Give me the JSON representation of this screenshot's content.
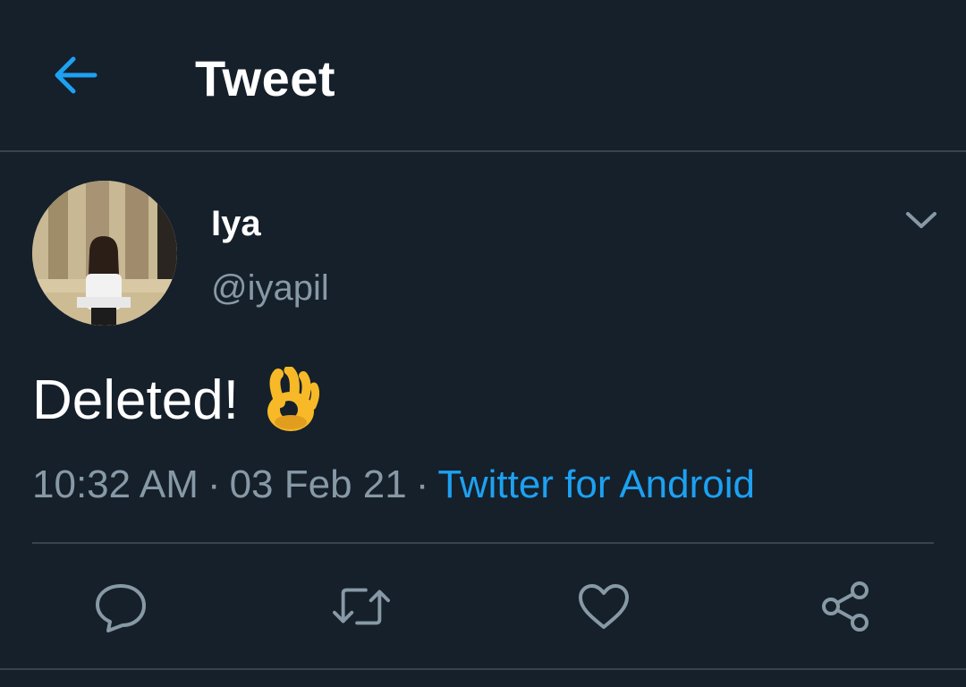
{
  "header": {
    "title": "Tweet",
    "back_icon": "arrow-left-icon"
  },
  "tweet": {
    "author_name": "Iya",
    "author_handle": "@iyapil",
    "text": "Deleted!",
    "emoji": "ok-hand-emoji",
    "time": "10:32 AM",
    "date": "03 Feb 21",
    "source": "Twitter for Android",
    "separator": "·"
  },
  "actions": [
    {
      "name": "reply",
      "icon": "reply-icon"
    },
    {
      "name": "retweet",
      "icon": "retweet-icon"
    },
    {
      "name": "like",
      "icon": "heart-icon"
    },
    {
      "name": "share",
      "icon": "share-icon"
    }
  ],
  "colors": {
    "background": "#15202b",
    "divider": "#38444d",
    "accent": "#1da1f2",
    "secondary_text": "#8899a6",
    "primary_text": "#ffffff"
  }
}
